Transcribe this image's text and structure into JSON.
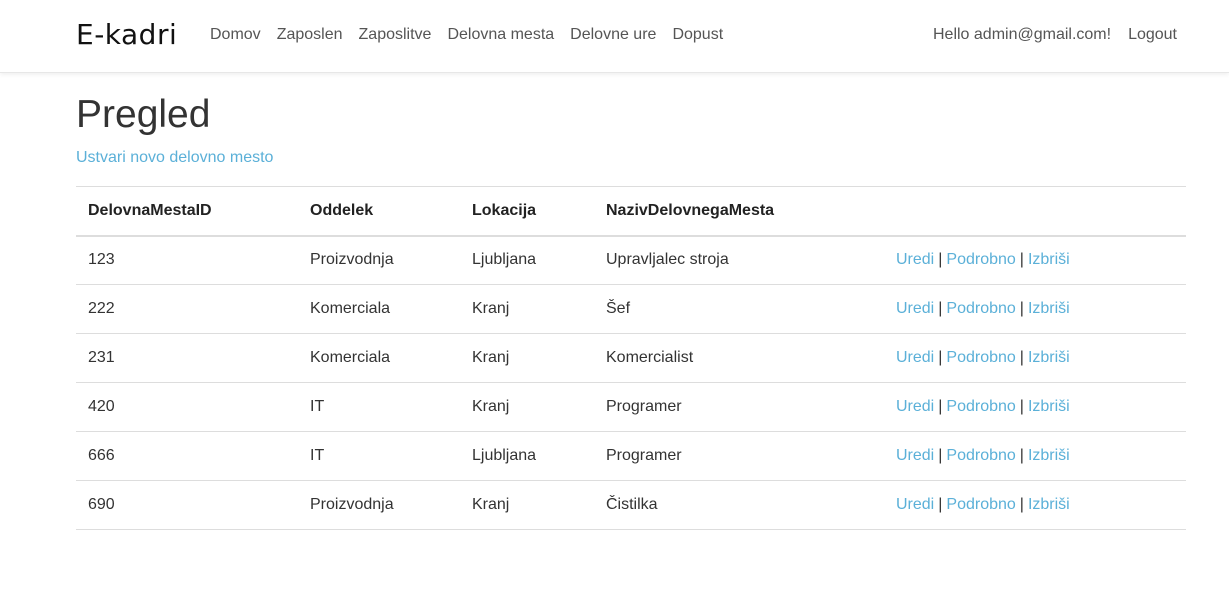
{
  "navbar": {
    "brand": "E-kadri",
    "links": [
      "Domov",
      "Zaposlen",
      "Zaposlitve",
      "Delovna mesta",
      "Delovne ure",
      "Dopust"
    ],
    "greeting": "Hello admin@gmail.com!",
    "logout": "Logout"
  },
  "page": {
    "title": "Pregled",
    "create_link": "Ustvari novo delovno mesto"
  },
  "table": {
    "headers": [
      "DelovnaMestaID",
      "Oddelek",
      "Lokacija",
      "NazivDelovnegaMesta",
      ""
    ],
    "actions": {
      "edit": "Uredi",
      "details": "Podrobno",
      "delete": "Izbriši",
      "separator": "|"
    },
    "rows": [
      [
        "123",
        "Proizvodnja",
        "Ljubljana",
        "Upravljalec stroja"
      ],
      [
        "222",
        "Komerciala",
        "Kranj",
        "Šef"
      ],
      [
        "231",
        "Komerciala",
        "Kranj",
        "Komercialist"
      ],
      [
        "420",
        "IT",
        "Kranj",
        "Programer"
      ],
      [
        "666",
        "IT",
        "Ljubljana",
        "Programer"
      ],
      [
        "690",
        "Proizvodnja",
        "Kranj",
        "Čistilka"
      ]
    ]
  },
  "colors": {
    "link": "#5bb0d8",
    "text": "#333333",
    "border": "#dddddd"
  }
}
